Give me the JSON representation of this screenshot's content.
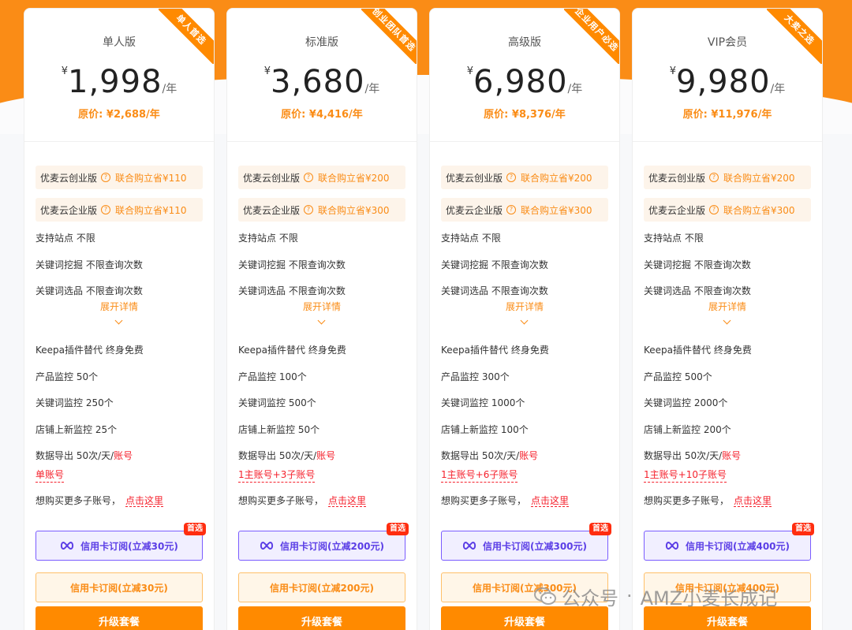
{
  "plans": [
    {
      "name": "单人版",
      "ribbon": "单人首选",
      "currency": "¥",
      "price": "1,998",
      "unit": "/年",
      "original": "原价: ¥2,688/年",
      "promos": [
        {
          "name": "优麦云创业版",
          "save": "联合购立省¥110"
        },
        {
          "name": "优麦云企业版",
          "save": "联合购立省¥110"
        }
      ],
      "features_top": [
        "支持站点  不限",
        "关键词挖掘  不限查询次数",
        "关键词选品  不限查询次数"
      ],
      "expand": "展开详情",
      "features_bottom": [
        "Keepa插件替代  终身免费",
        "产品监控  50个",
        "关键词监控  250个",
        "店铺上新监控  25个"
      ],
      "export_prefix": "数据导出  50次/天/",
      "export_suffix": "账号",
      "accounts": "单账号",
      "more_text": "想购买更多子账号，",
      "more_link": "点击这里",
      "badge": "首选",
      "btn_card_sub": "信用卡订阅(立减30元)",
      "btn_card": "信用卡订阅(立减30元)",
      "btn_upgrade": "升级套餐"
    },
    {
      "name": "标准版",
      "ribbon": "创业团队首选",
      "currency": "¥",
      "price": "3,680",
      "unit": "/年",
      "original": "原价: ¥4,416/年",
      "promos": [
        {
          "name": "优麦云创业版",
          "save": "联合购立省¥200"
        },
        {
          "name": "优麦云企业版",
          "save": "联合购立省¥300"
        }
      ],
      "features_top": [
        "支持站点  不限",
        "关键词挖掘  不限查询次数",
        "关键词选品  不限查询次数"
      ],
      "expand": "展开详情",
      "features_bottom": [
        "Keepa插件替代  终身免费",
        "产品监控  100个",
        "关键词监控  500个",
        "店铺上新监控  50个"
      ],
      "export_prefix": "数据导出  50次/天/",
      "export_suffix": "账号",
      "accounts": "1主账号+3子账号",
      "more_text": "想购买更多子账号，",
      "more_link": "点击这里",
      "badge": "首选",
      "btn_card_sub": "信用卡订阅(立减200元)",
      "btn_card": "信用卡订阅(立减200元)",
      "btn_upgrade": "升级套餐"
    },
    {
      "name": "高级版",
      "ribbon": "企业用户必选",
      "currency": "¥",
      "price": "6,980",
      "unit": "/年",
      "original": "原价: ¥8,376/年",
      "promos": [
        {
          "name": "优麦云创业版",
          "save": "联合购立省¥200"
        },
        {
          "name": "优麦云企业版",
          "save": "联合购立省¥300"
        }
      ],
      "features_top": [
        "支持站点  不限",
        "关键词挖掘  不限查询次数",
        "关键词选品  不限查询次数"
      ],
      "expand": "展开详情",
      "features_bottom": [
        "Keepa插件替代  终身免费",
        "产品监控  300个",
        "关键词监控  1000个",
        "店铺上新监控  100个"
      ],
      "export_prefix": "数据导出  50次/天/",
      "export_suffix": "账号",
      "accounts": "1主账号+6子账号",
      "more_text": "想购买更多子账号，",
      "more_link": "点击这里",
      "badge": "首选",
      "btn_card_sub": "信用卡订阅(立减300元)",
      "btn_card": "信用卡订阅(立减300元)",
      "btn_upgrade": "升级套餐"
    },
    {
      "name": "VIP会员",
      "ribbon": "大卖之选",
      "currency": "¥",
      "price": "9,980",
      "unit": "/年",
      "original": "原价: ¥11,976/年",
      "promos": [
        {
          "name": "优麦云创业版",
          "save": "联合购立省¥200"
        },
        {
          "name": "优麦云企业版",
          "save": "联合购立省¥300"
        }
      ],
      "features_top": [
        "支持站点  不限",
        "关键词挖掘  不限查询次数",
        "关键词选品  不限查询次数"
      ],
      "expand": "展开详情",
      "features_bottom": [
        "Keepa插件替代  终身免费",
        "产品监控  500个",
        "关键词监控  2000个",
        "店铺上新监控  200个"
      ],
      "export_prefix": "数据导出  50次/天/",
      "export_suffix": "账号",
      "accounts": "1主账号+10子账号",
      "more_text": "想购买更多子账号，",
      "more_link": "点击这里",
      "badge": "首选",
      "btn_card_sub": "信用卡订阅(立减400元)",
      "btn_card": "信用卡订阅(立减400元)",
      "btn_upgrade": "升级套餐"
    }
  ],
  "watermark": {
    "prefix": "公众号",
    "sep": "·",
    "name": "AMZ小麦长成记"
  },
  "colors": {
    "accent": "#fa8c16",
    "button": "#ff8a00",
    "link_red": "#f5222d",
    "purple": "#7a5cff"
  }
}
